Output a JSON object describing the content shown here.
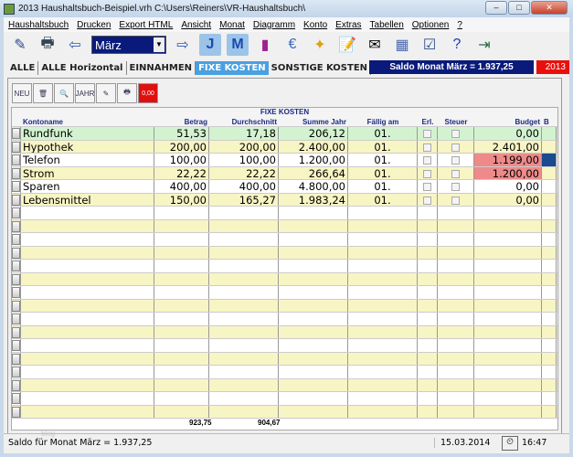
{
  "window": {
    "title": "2013 Haushaltsbuch-Beispiel.vrh   C:\\Users\\Reiners\\VR-Haushaltsbuch\\"
  },
  "menu": [
    "Haushaltsbuch",
    "Drucken",
    "Export HTML",
    "Ansicht",
    "Monat",
    "Diagramm",
    "Konto",
    "Extras",
    "Tabellen",
    "Optionen",
    "?"
  ],
  "toolbar": {
    "month": "März",
    "j": "J",
    "m": "M"
  },
  "tabs": [
    "ALLE",
    "ALLE Horizontal",
    "EINNAHMEN",
    "FIXE  KOSTEN",
    "SONSTIGE  KOSTEN"
  ],
  "saldo_banner": "Saldo Monat März = 1.937,25",
  "year": "2013",
  "inner_tools": {
    "new": "NEU",
    "year": "JAHR",
    "zero": "0,00"
  },
  "grid": {
    "title": "FIXE KOSTEN",
    "headers": [
      "Kontoname",
      "Betrag",
      "Durchschnitt",
      "Summe Jahr",
      "Fällig am",
      "Erl.",
      "Steuer",
      "Budget",
      "B"
    ],
    "rows": [
      {
        "name": "Rundfunk",
        "betrag": "51,53",
        "avg": "17,18",
        "sum": "206,12",
        "due": "01.",
        "budget": "0,00",
        "style": "g"
      },
      {
        "name": "Hypothek",
        "betrag": "200,00",
        "avg": "200,00",
        "sum": "2.400,00",
        "due": "01.",
        "budget": "2.401,00",
        "style": "y"
      },
      {
        "name": "Telefon",
        "betrag": "100,00",
        "avg": "100,00",
        "sum": "1.200,00",
        "due": "01.",
        "budget": "1.199,00",
        "style": "w",
        "over": true
      },
      {
        "name": "Strom",
        "betrag": "22,22",
        "avg": "22,22",
        "sum": "266,64",
        "due": "01.",
        "budget": "1.200,00",
        "style": "y",
        "over": true
      },
      {
        "name": "Sparen",
        "betrag": "400,00",
        "avg": "400,00",
        "sum": "4.800,00",
        "due": "01.",
        "budget": "0,00",
        "style": "w"
      },
      {
        "name": "Lebensmittel",
        "betrag": "150,00",
        "avg": "165,27",
        "sum": "1.983,24",
        "due": "01.",
        "budget": "0,00",
        "style": "y"
      }
    ],
    "total_betrag": "923,75",
    "total_avg": "904,67",
    "watermark": "blog"
  },
  "status": {
    "text": "Saldo für Monat März = 1.937,25",
    "date": "15.03.2014",
    "time": "16:47"
  }
}
